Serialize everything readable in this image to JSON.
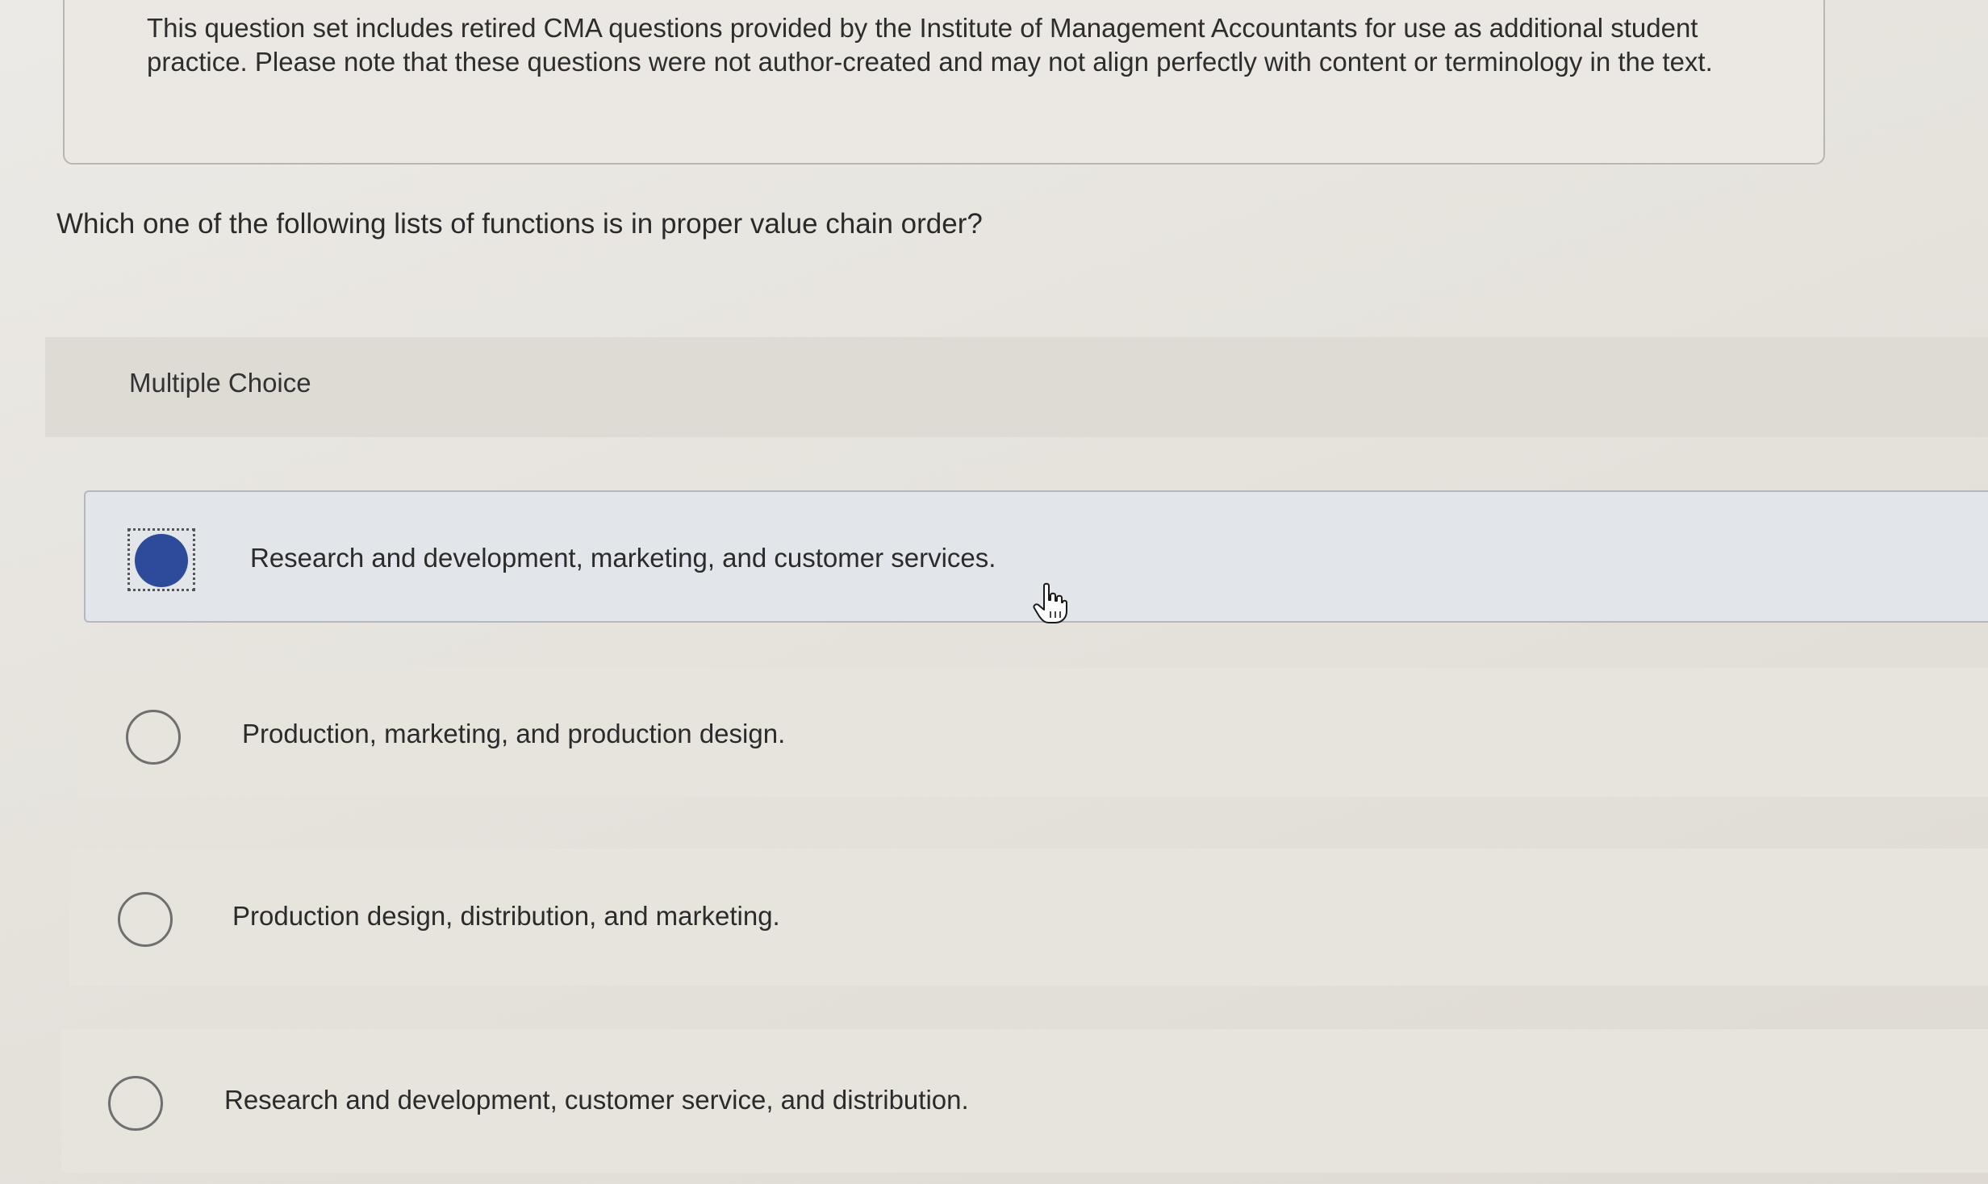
{
  "notice": {
    "text": "This question set includes retired CMA questions provided by the Institute of Management Accountants for use as additional student practice. Please note that these questions were not author-created and may not align perfectly with content or terminology in the text."
  },
  "question": {
    "text": "Which one of the following lists of functions is in proper value chain order?"
  },
  "answer_section": {
    "header": "Multiple Choice",
    "choices": [
      {
        "label": "Research and development, marketing, and customer services.",
        "selected": true
      },
      {
        "label": "Production, marketing, and production design.",
        "selected": false
      },
      {
        "label": "Production design, distribution, and marketing.",
        "selected": false
      },
      {
        "label": "Research and development, customer service, and distribution.",
        "selected": false
      }
    ]
  },
  "colors": {
    "selected_radio": "#2e4a9a",
    "selected_row_bg": "#e2e5e9"
  },
  "icons": {
    "cursor": "hand-pointer-icon"
  }
}
